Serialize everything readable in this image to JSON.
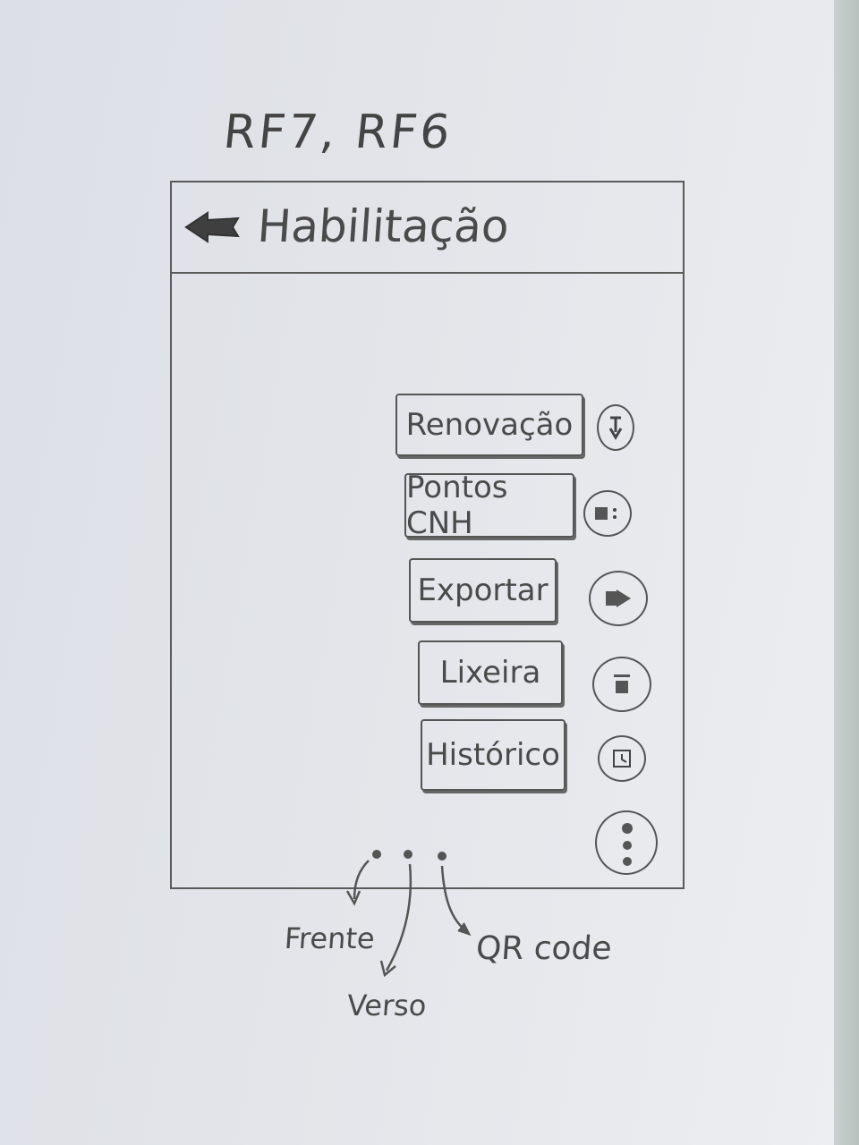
{
  "requirements": "RF7, RF6",
  "header": {
    "back_icon": "back-arrow-icon",
    "title": "Habilitação"
  },
  "menu": {
    "items": [
      {
        "label": "Renovação",
        "icon": "renewal-icon"
      },
      {
        "label": "Pontos CNH",
        "icon": "points-icon"
      },
      {
        "label": "Exportar",
        "icon": "export-icon"
      },
      {
        "label": "Lixeira",
        "icon": "trash-icon"
      },
      {
        "label": "Histórico",
        "icon": "history-icon"
      }
    ],
    "more_icon": "more-vertical-icon"
  },
  "pager": {
    "annotations": [
      "Frente",
      "Verso",
      "QR code"
    ]
  },
  "colors": {
    "paper": "#e3e5ea",
    "pencil": "#4a4a4a"
  }
}
